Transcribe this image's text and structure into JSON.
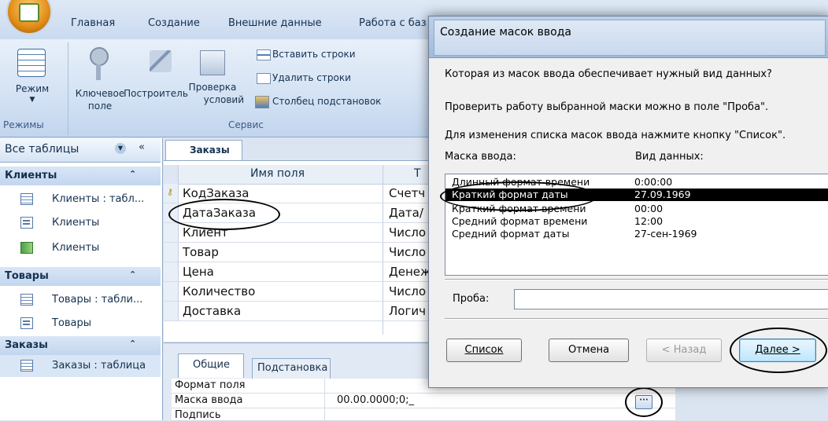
{
  "ribbon": {
    "tabs": [
      "Главная",
      "Создание",
      "Внешние данные",
      "Работа с баз"
    ],
    "buttons": {
      "mode": "Режим",
      "key_field_1": "Ключевое",
      "key_field_2": "поле",
      "builder": "Построитель",
      "check_1": "Проверка",
      "check_2": "условий",
      "insert_rows": "Вставить строки",
      "delete_rows": "Удалить строки",
      "lookup_column": "Столбец подстановок"
    },
    "groups": {
      "modes": "Режимы",
      "service": "Сервис"
    }
  },
  "nav": {
    "header": "Все таблицы",
    "groups": [
      {
        "label": "Клиенты",
        "items": [
          {
            "label": "Клиенты : табл...",
            "icon": "table-icon"
          },
          {
            "label": "Клиенты",
            "icon": "form-icon"
          },
          {
            "label": "Клиенты",
            "icon": "report-icon"
          }
        ]
      },
      {
        "label": "Товары",
        "items": [
          {
            "label": "Товары : табли...",
            "icon": "table-icon"
          },
          {
            "label": "Товары",
            "icon": "form-icon"
          }
        ]
      },
      {
        "label": "Заказы",
        "items": [
          {
            "label": "Заказы : таблица",
            "icon": "table-icon"
          }
        ]
      }
    ]
  },
  "design": {
    "tab": "Заказы",
    "col_name": "Имя поля",
    "col_type": "Т",
    "rows": [
      {
        "name": "КодЗаказа",
        "type": "Счетч"
      },
      {
        "name": "ДатаЗаказа",
        "type": "Дата/"
      },
      {
        "name": "Клиент",
        "type": "Число"
      },
      {
        "name": "Товар",
        "type": "Число"
      },
      {
        "name": "Цена",
        "type": "Денеж"
      },
      {
        "name": "Количество",
        "type": "Число"
      },
      {
        "name": "Доставка",
        "type": "Логич"
      }
    ],
    "prop_tabs": [
      "Общие",
      "Подстановка"
    ],
    "props": [
      {
        "label": "Формат поля",
        "value": ""
      },
      {
        "label": "Маска ввода",
        "value": "00.00.0000;0;_"
      },
      {
        "label": "Подпись",
        "value": ""
      }
    ]
  },
  "dialog": {
    "title": "Создание масок ввода",
    "line1": "Которая из масок ввода обеспечивает нужный вид данных?",
    "line2": "Проверить работу выбранной маски можно в поле \"Проба\".",
    "line3": "Для изменения списка масок ввода нажмите кнопку \"Список\".",
    "col_mask": "Маска ввода:",
    "col_view": "Вид данных:",
    "items": [
      {
        "mask": "Длинный формат времени",
        "view": "0:00:00"
      },
      {
        "mask": "Краткий формат даты",
        "view": "27.09.1969"
      },
      {
        "mask": "Краткий формат времени",
        "view": "00:00"
      },
      {
        "mask": "Средний формат времени",
        "view": "12:00"
      },
      {
        "mask": "Средний формат даты",
        "view": "27-сен-1969"
      }
    ],
    "probe_label": "Проба:",
    "probe_value": "",
    "btn_list": "Список",
    "btn_cancel": "Отмена",
    "btn_back": "< Назад",
    "btn_next": "Далее >"
  }
}
